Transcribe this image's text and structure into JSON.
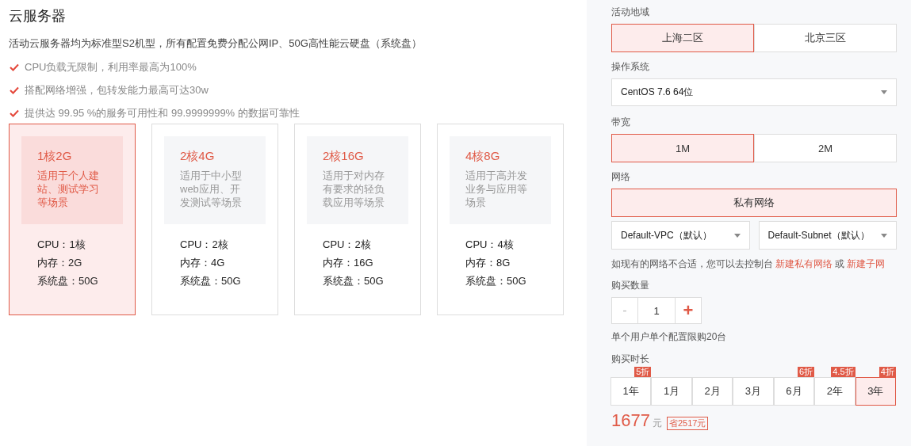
{
  "title": "云服务器",
  "intro": "活动云服务器均为标准型S2机型，所有配置免费分配公网IP、50G高性能云硬盘（系统盘）",
  "features": [
    "CPU负载无限制，利用率最高为100%",
    "搭配网络增强，包转发能力最高可达30w",
    "提供达 99.95 %的服务可用性和 99.9999999% 的数据可靠性"
  ],
  "plans": [
    {
      "name": "1核2G",
      "desc": "适用于个人建站、测试学习等场景",
      "specs": [
        "CPU：1核",
        "内存：2G",
        "系统盘：50G"
      ],
      "selected": true
    },
    {
      "name": "2核4G",
      "desc": "适用于中小型web应用、开发测试等场景",
      "specs": [
        "CPU：2核",
        "内存：4G",
        "系统盘：50G"
      ],
      "selected": false
    },
    {
      "name": "2核16G",
      "desc": "适用于对内存有要求的轻负载应用等场景",
      "specs": [
        "CPU：2核",
        "内存：16G",
        "系统盘：50G"
      ],
      "selected": false
    },
    {
      "name": "4核8G",
      "desc": "适用于高并发业务与应用等场景",
      "specs": [
        "CPU：4核",
        "内存：8G",
        "系统盘：50G"
      ],
      "selected": false
    }
  ],
  "region": {
    "label": "活动地域",
    "options": [
      {
        "label": "上海二区",
        "selected": true
      },
      {
        "label": "北京三区",
        "selected": false
      }
    ]
  },
  "os": {
    "label": "操作系统",
    "value": "CentOS 7.6 64位"
  },
  "bandwidth": {
    "label": "带宽",
    "options": [
      {
        "label": "1M",
        "selected": true
      },
      {
        "label": "2M",
        "selected": false
      }
    ]
  },
  "network": {
    "label": "网络",
    "options": [
      {
        "label": "私有网络",
        "selected": true
      }
    ],
    "vpc": "Default-VPC（默认）",
    "subnet": "Default-Subnet（默认）",
    "hint": "如现有的网络不合适，您可以去控制台",
    "link1": "新建私有网络",
    "or": "或",
    "link2": "新建子网"
  },
  "quantity": {
    "label": "购买数量",
    "minus": "-",
    "value": "1",
    "plus": "+",
    "limit": "单个用户单个配置限购20台"
  },
  "duration": {
    "label": "购买时长",
    "options": [
      {
        "label": "1年",
        "badge": "5折",
        "selected": false
      },
      {
        "label": "1月",
        "selected": false
      },
      {
        "label": "2月",
        "selected": false
      },
      {
        "label": "3月",
        "selected": false
      },
      {
        "label": "6月",
        "badge": "6折",
        "selected": false
      },
      {
        "label": "2年",
        "badge": "4.5折",
        "selected": false
      },
      {
        "label": "3年",
        "badge": "4折",
        "selected": true
      }
    ]
  },
  "price": {
    "amount": "1677",
    "unit": "元",
    "saving": "省2517元"
  }
}
